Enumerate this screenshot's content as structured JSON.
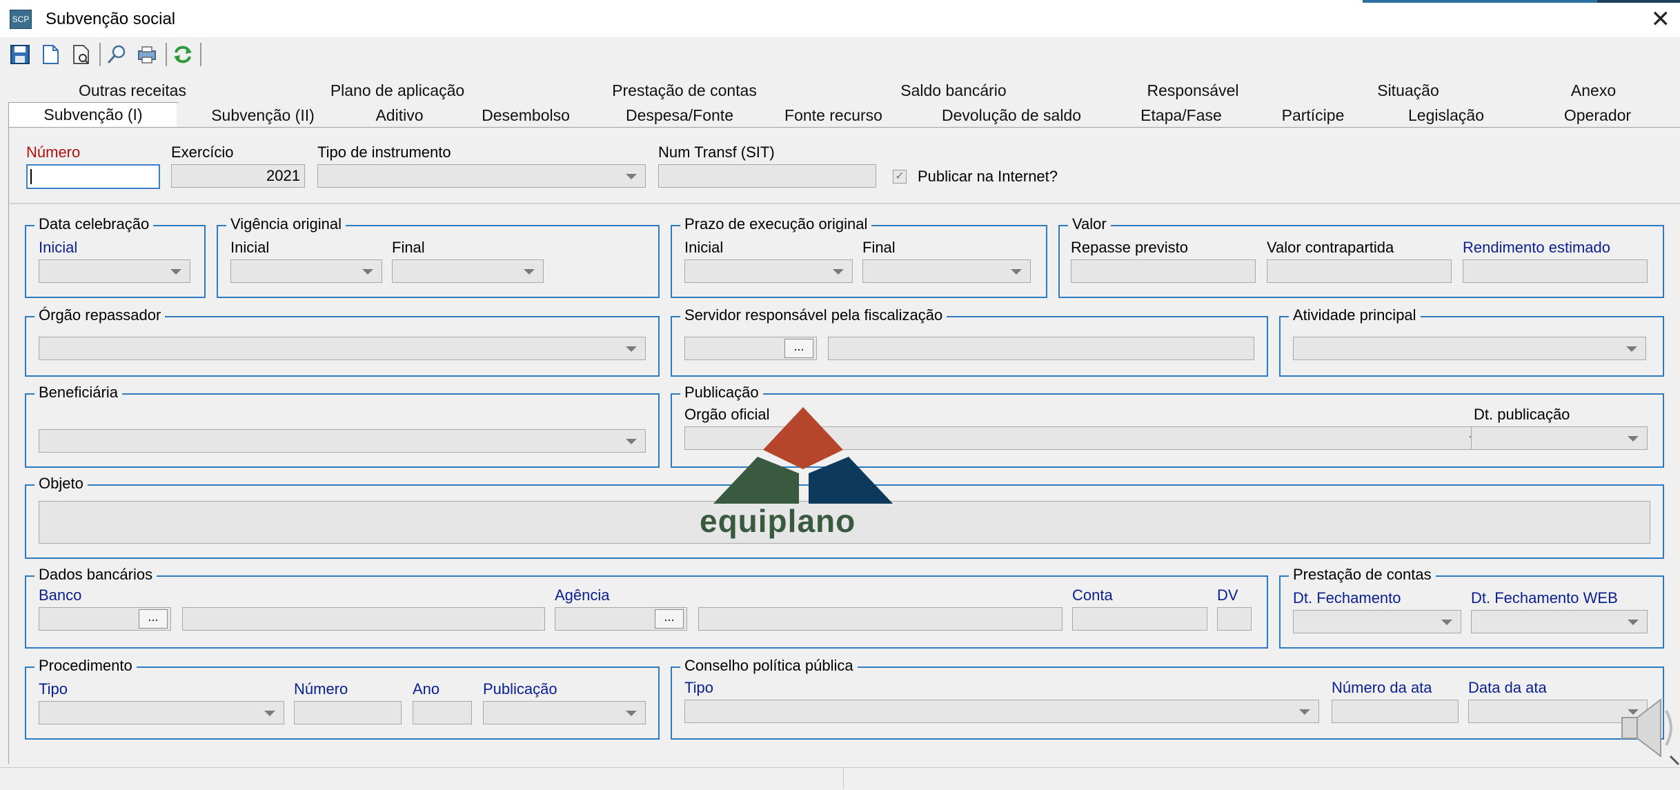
{
  "window": {
    "title": "Subvenção social",
    "app_icon_text": "SCP"
  },
  "toolbar": {
    "buttons": [
      "save-icon",
      "new-document-icon",
      "preview-icon",
      "find-icon",
      "print-icon",
      "refresh-icon"
    ]
  },
  "tabs_row1": [
    "Outras receitas",
    "Plano de aplicação",
    "Prestação de contas",
    "Saldo bancário",
    "Responsável",
    "Situação",
    "Anexo"
  ],
  "tabs_row2": [
    "Subvenção (I)",
    "Subvenção (II)",
    "Aditivo",
    "Desembolso",
    "Despesa/Fonte",
    "Fonte recurso",
    "Devolução de saldo",
    "Etapa/Fase",
    "Partícipe",
    "Legislação",
    "Operador"
  ],
  "header": {
    "numero_label": "Número",
    "exercicio_label": "Exercício",
    "exercicio_value": "2021",
    "tipo_instrumento_label": "Tipo de instrumento",
    "num_transf_label": "Num Transf (SIT)",
    "publicar_label": "Publicar na Internet?"
  },
  "groups": {
    "data_celebracao": {
      "title": "Data celebração",
      "inicial": "Inicial"
    },
    "vigencia": {
      "title": "Vigência original",
      "inicial": "Inicial",
      "final": "Final"
    },
    "prazo": {
      "title": "Prazo de execução original",
      "inicial": "Inicial",
      "final": "Final"
    },
    "valor": {
      "title": "Valor",
      "repasse": "Repasse previsto",
      "contrapartida": "Valor contrapartida",
      "rendimento": "Rendimento estimado"
    },
    "orgao_repassador": {
      "title": "Órgão repassador"
    },
    "servidor": {
      "title": "Servidor responsável pela fiscalização",
      "btn": "..."
    },
    "atividade": {
      "title": "Atividade principal"
    },
    "beneficiaria": {
      "title": "Beneficiária"
    },
    "publicacao": {
      "title": "Publicação",
      "orgao_oficial": "Orgão oficial",
      "dt_publicacao": "Dt. publicação"
    },
    "objeto": {
      "title": "Objeto"
    },
    "dados_bancarios": {
      "title": "Dados bancários",
      "banco": "Banco",
      "agencia": "Agência",
      "conta": "Conta",
      "dv": "DV",
      "btn": "..."
    },
    "prestacao": {
      "title": "Prestação de contas",
      "dt_fechamento": "Dt. Fechamento",
      "dt_fechamento_web": "Dt. Fechamento WEB"
    },
    "procedimento": {
      "title": "Procedimento",
      "tipo": "Tipo",
      "numero": "Número",
      "ano": "Ano",
      "publicacao": "Publicação"
    },
    "conselho": {
      "title": "Conselho política pública",
      "tipo": "Tipo",
      "numero_ata": "Número da ata",
      "data_ata": "Data da ata"
    }
  },
  "logo": {
    "text": "equiplano"
  },
  "colors": {
    "group_border": "#2c7bc0",
    "label_blue": "#0a1f8f",
    "label_red": "#b01010",
    "logo_red": "#b5462b",
    "logo_green": "#3a5a40",
    "logo_blue": "#0d3a5c"
  }
}
